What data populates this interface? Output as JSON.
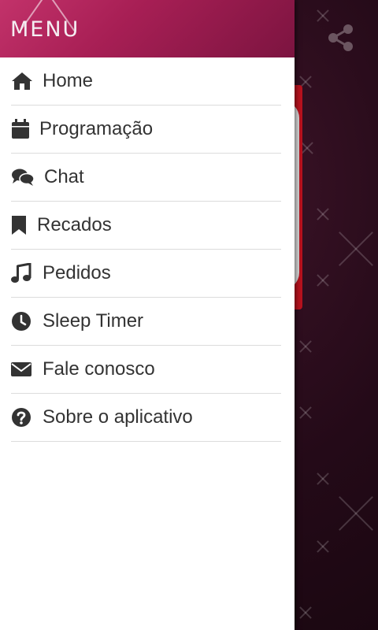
{
  "drawer": {
    "title": "MENU",
    "items": [
      {
        "label": "Home",
        "icon": "home-icon"
      },
      {
        "label": "Programação",
        "icon": "calendar-icon"
      },
      {
        "label": "Chat",
        "icon": "chat-icon"
      },
      {
        "label": "Recados",
        "icon": "bookmark-icon"
      },
      {
        "label": "Pedidos",
        "icon": "music-note-icon"
      },
      {
        "label": "Sleep Timer",
        "icon": "clock-icon"
      },
      {
        "label": "Fale conosco",
        "icon": "envelope-icon"
      },
      {
        "label": "Sobre o aplicativo",
        "icon": "question-circle-icon"
      }
    ]
  },
  "app": {
    "share_icon": "share-icon"
  },
  "colors": {
    "header_gradient_start": "#c2326a",
    "header_gradient_end": "#7c1440",
    "text": "#333333",
    "background_dark": "#1e0a14",
    "player_red": "#b8121e"
  }
}
